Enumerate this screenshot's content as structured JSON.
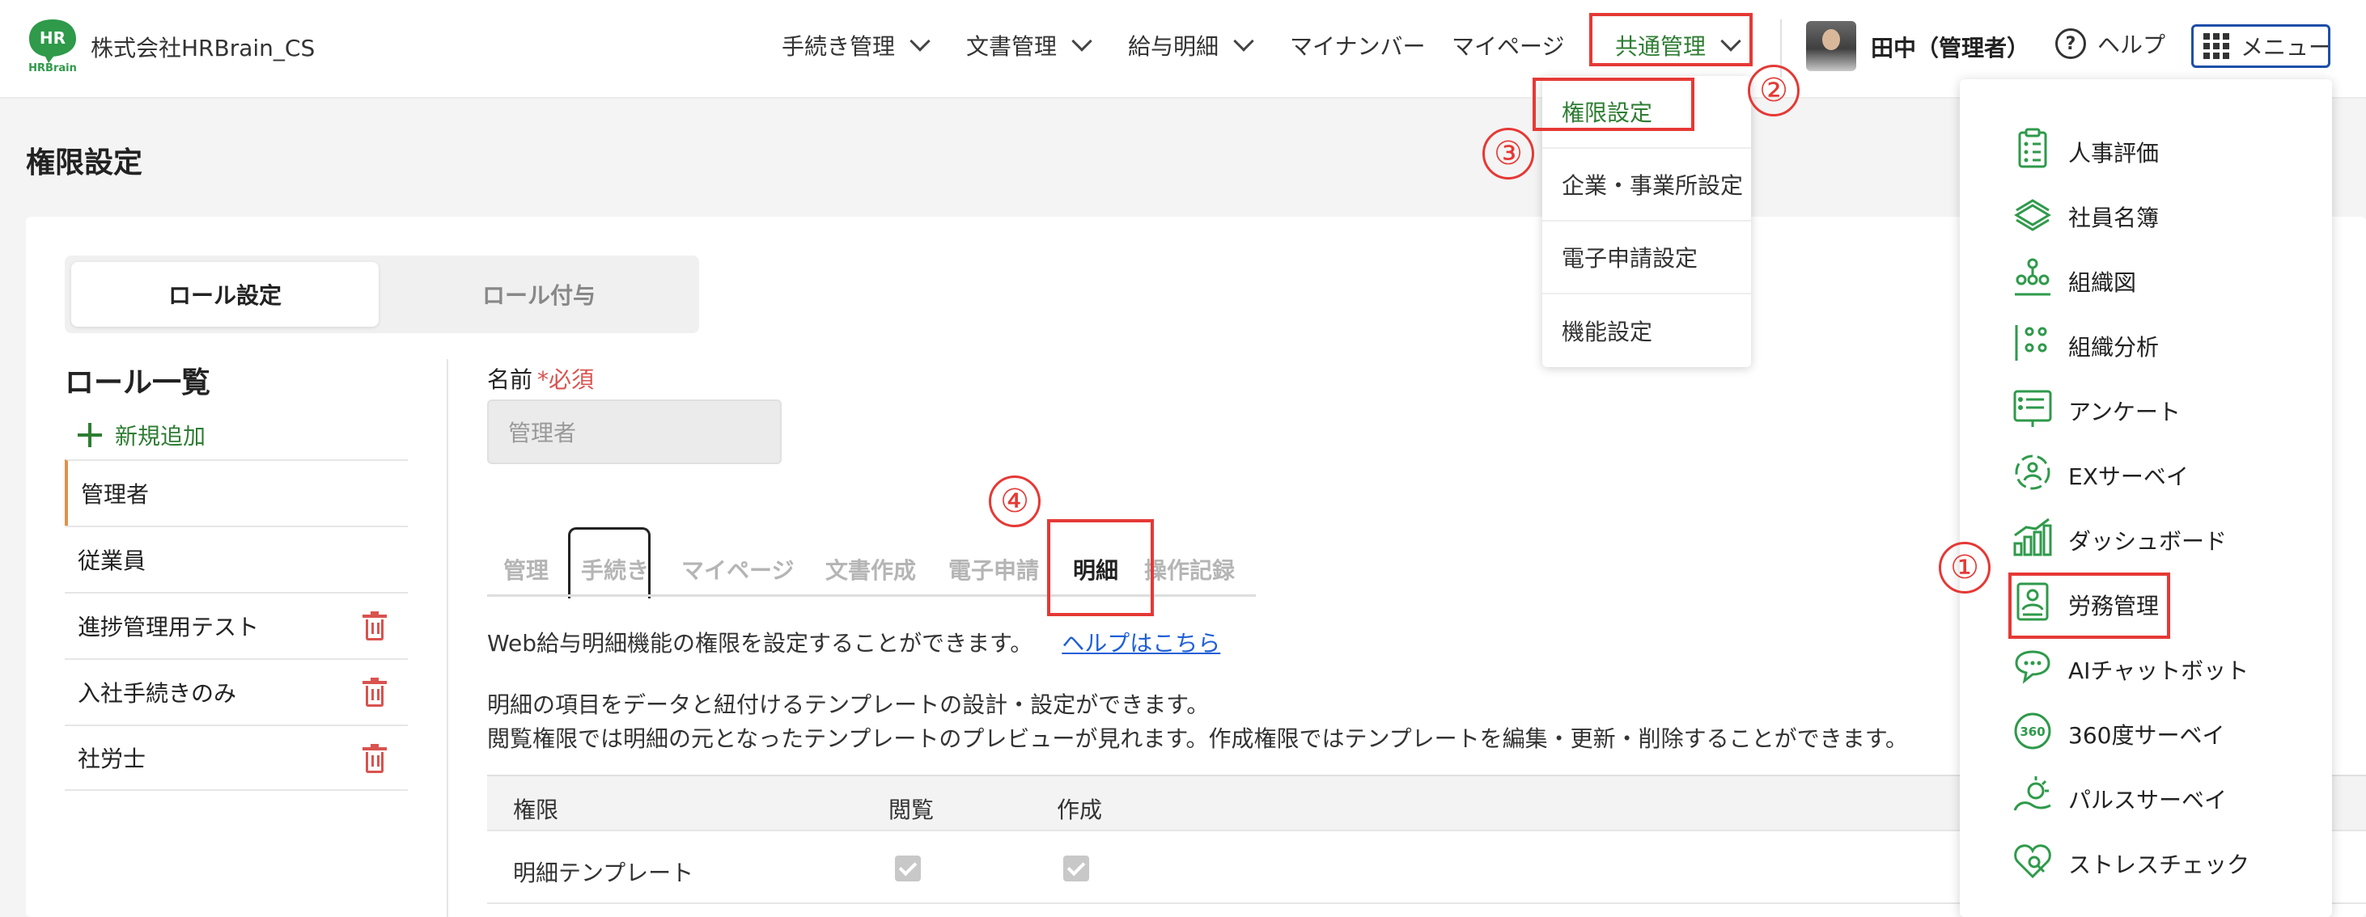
{
  "header": {
    "logo_text": "HR",
    "logo_subtext": "HRBrain",
    "company_name": "株式会社HRBrain_CS",
    "nav": [
      {
        "label": "手続き管理"
      },
      {
        "label": "文書管理"
      },
      {
        "label": "給与明細"
      },
      {
        "label": "マイナンバー"
      },
      {
        "label": "マイページ"
      },
      {
        "label": "共通管理"
      }
    ],
    "user_name": "田中（管理者）",
    "help_label": "ヘルプ",
    "menu_label": "メニュー",
    "accent_color": "#2e7d32"
  },
  "dropdown": {
    "items": [
      {
        "label": "権限設定"
      },
      {
        "label": "企業・事業所設定"
      },
      {
        "label": "電子申請設定"
      },
      {
        "label": "機能設定"
      }
    ]
  },
  "page": {
    "title": "権限設定",
    "role_tabs": [
      {
        "label": "ロール設定"
      },
      {
        "label": "ロール付与"
      }
    ],
    "list_title": "ロール一覧",
    "add_new_label": "新規追加",
    "roles": [
      {
        "name": "管理者"
      },
      {
        "name": "従業員"
      },
      {
        "name": "進捗管理用テスト"
      },
      {
        "name": "入社手続きのみ"
      },
      {
        "name": "社労士"
      }
    ],
    "name_label": "名前",
    "required_label": "*必須",
    "name_value": "管理者",
    "perm_tabs": [
      {
        "label": "管理"
      },
      {
        "label": "手続き"
      },
      {
        "label": "マイページ"
      },
      {
        "label": "文書作成"
      },
      {
        "label": "電子申請"
      },
      {
        "label": "明細"
      },
      {
        "label": "操作記録"
      }
    ],
    "desc1": "Web給与明細機能の権限を設定することができます。",
    "help_link": "ヘルプはこちら",
    "desc2": "明細の項目をデータと紐付けるテンプレートの設計・設定ができます。",
    "desc3": "閲覧権限では明細の元となったテンプレートのプレビューが見れます。作成権限ではテンプレートを編集・更新・削除することができます。",
    "table": {
      "headers": [
        "権限",
        "閲覧",
        "作成"
      ],
      "rows": [
        {
          "name": "明細テンプレート",
          "view": true,
          "create": true
        }
      ]
    }
  },
  "side_menu": {
    "items": [
      {
        "label": "人事評価",
        "icon": "evaluation-icon"
      },
      {
        "label": "社員名簿",
        "icon": "directory-icon"
      },
      {
        "label": "組織図",
        "icon": "org-chart-icon"
      },
      {
        "label": "組織分析",
        "icon": "org-analysis-icon"
      },
      {
        "label": "アンケート",
        "icon": "survey-icon"
      },
      {
        "label": "EXサーベイ",
        "icon": "ex-survey-icon"
      },
      {
        "label": "ダッシュボード",
        "icon": "dashboard-icon"
      },
      {
        "label": "労務管理",
        "icon": "labor-icon"
      },
      {
        "label": "AIチャットボット",
        "icon": "chatbot-icon"
      },
      {
        "label": "360度サーベイ",
        "icon": "survey-360-icon"
      },
      {
        "label": "パルスサーベイ",
        "icon": "pulse-survey-icon"
      },
      {
        "label": "ストレスチェック",
        "icon": "stress-check-icon"
      }
    ]
  },
  "annotations": {
    "n1": "①",
    "n2": "②",
    "n3": "③",
    "n4": "④",
    "color": "#e53935"
  }
}
